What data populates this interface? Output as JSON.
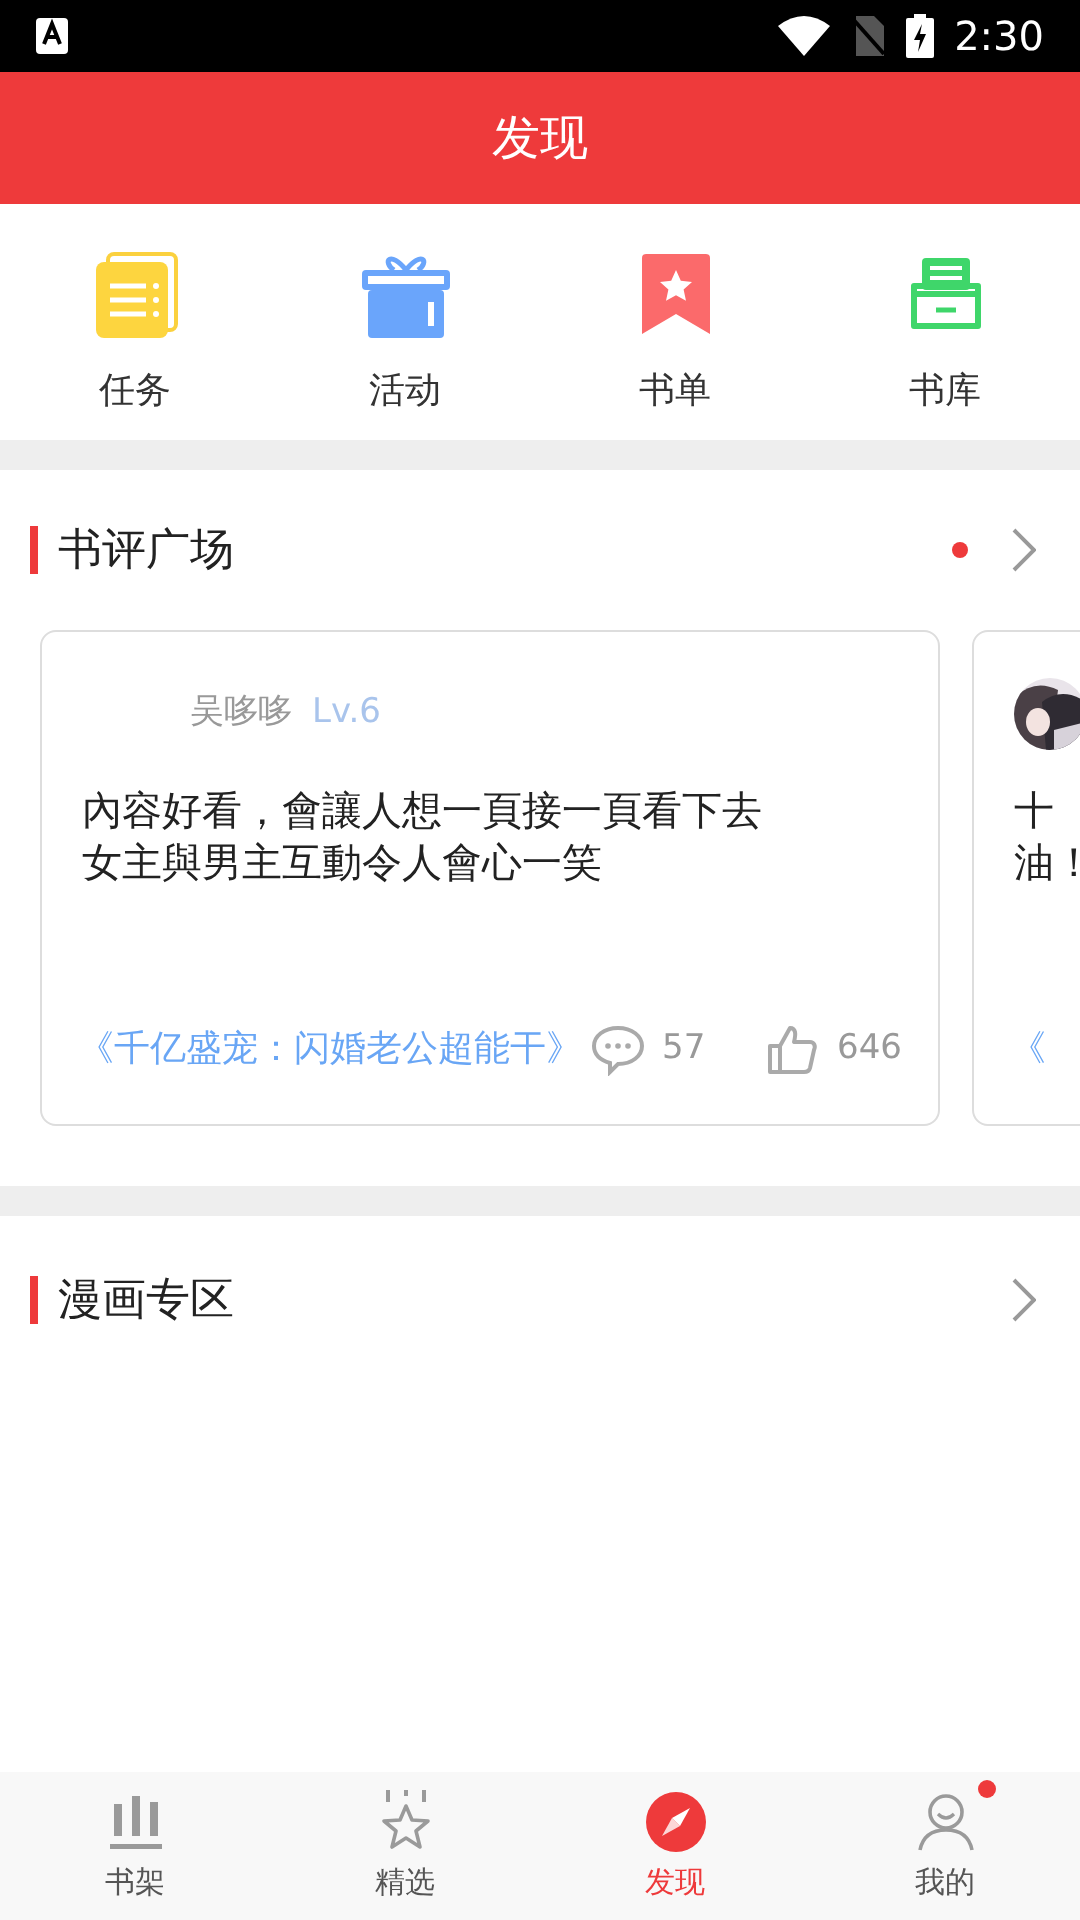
{
  "status_bar": {
    "time": "2:30"
  },
  "header": {
    "title": "发现"
  },
  "shortcuts": [
    {
      "kind": "tasks",
      "label": "任务"
    },
    {
      "kind": "gift",
      "label": "活动"
    },
    {
      "kind": "bookmark",
      "label": "书单"
    },
    {
      "kind": "tray",
      "label": "书库"
    }
  ],
  "review_section": {
    "title": "书评广场",
    "dot": true,
    "cards": [
      {
        "avatar": false,
        "user": "吴哆哆",
        "level": "Lv.6",
        "lines": [
          "內容好看，會讓人想一頁接一頁看下去",
          "女主與男主互動令人會心一笑"
        ],
        "book": "《千亿盛宠：闪婚老公超能干》",
        "comments": "57",
        "likes": "646"
      },
      {
        "avatar": true,
        "lines": [
          "十",
          "油！"
        ],
        "book": "《"
      }
    ]
  },
  "comic_section": {
    "title": "漫画专区"
  },
  "tab_bar": [
    {
      "kind": "shelf",
      "label": "书架",
      "selected": false,
      "badge": false
    },
    {
      "kind": "star",
      "label": "精选",
      "selected": false,
      "badge": false
    },
    {
      "kind": "compass",
      "label": "发现",
      "selected": true,
      "badge": false
    },
    {
      "kind": "person",
      "label": "我的",
      "selected": false,
      "badge": true
    }
  ]
}
